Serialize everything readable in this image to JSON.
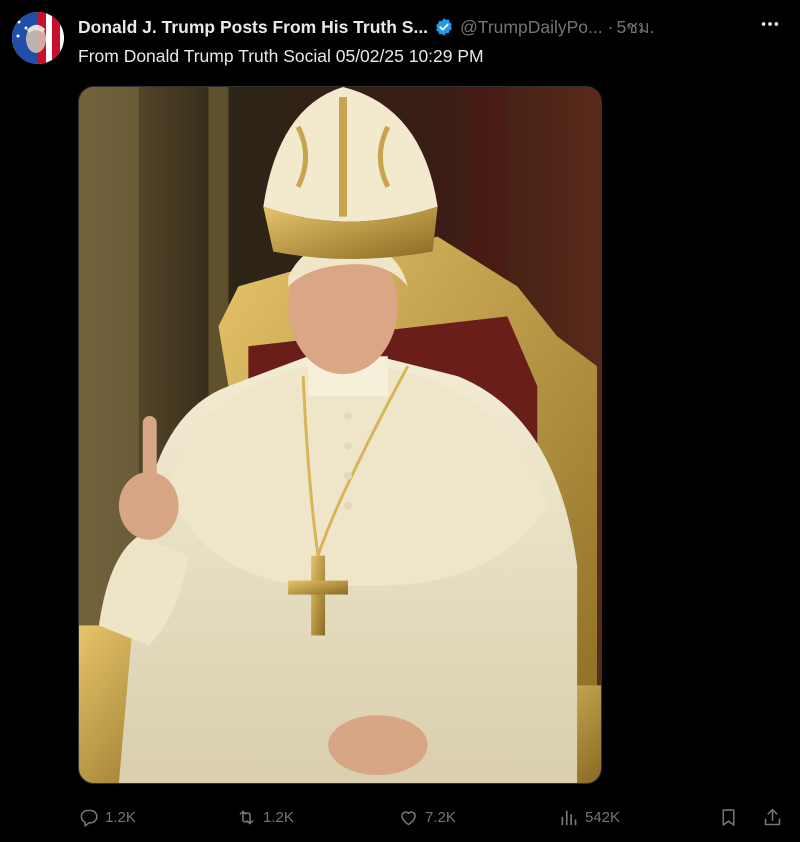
{
  "post": {
    "author_name": "Donald J. Trump Posts From His Truth S...",
    "handle": "@TrumpDailyPo...",
    "separator": "·",
    "time": "5ชม.",
    "text": "From Donald Trump Truth Social 05/02/25 10:29 PM"
  },
  "actions": {
    "replies": "1.2K",
    "reposts": "1.2K",
    "likes": "7.2K",
    "views": "542K"
  },
  "icons": {
    "verified": "verified-badge-icon",
    "more": "more-dots-icon",
    "reply": "reply-bubble-icon",
    "repost": "repost-arrows-icon",
    "like": "heart-icon",
    "views": "views-bars-icon",
    "bookmark": "bookmark-icon",
    "share": "share-upload-icon"
  },
  "colors": {
    "background": "#000000",
    "text_primary": "#e7e9ea",
    "text_secondary": "#71767b",
    "verified_blue": "#1d9bf0"
  }
}
